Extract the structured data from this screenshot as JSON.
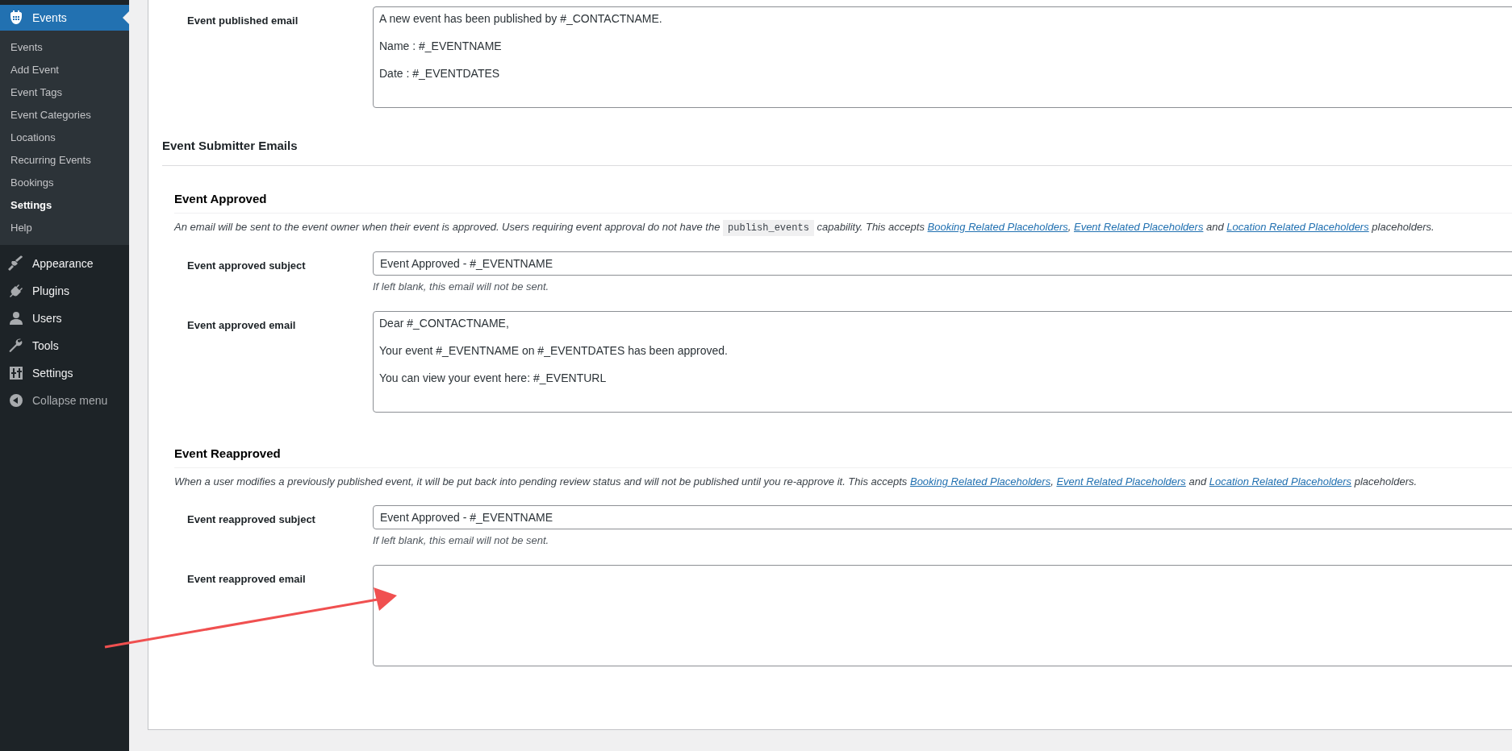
{
  "sidebar": {
    "current_menu": {
      "label": "Events"
    },
    "submenu": [
      {
        "label": "Events",
        "selected": false
      },
      {
        "label": "Add Event",
        "selected": false
      },
      {
        "label": "Event Tags",
        "selected": false
      },
      {
        "label": "Event Categories",
        "selected": false
      },
      {
        "label": "Locations",
        "selected": false
      },
      {
        "label": "Recurring Events",
        "selected": false
      },
      {
        "label": "Bookings",
        "selected": false
      },
      {
        "label": "Settings",
        "selected": true
      },
      {
        "label": "Help",
        "selected": false
      }
    ],
    "menu": [
      {
        "label": "Appearance",
        "kind": "brush"
      },
      {
        "label": "Plugins",
        "kind": "plug"
      },
      {
        "label": "Users",
        "kind": "user"
      },
      {
        "label": "Tools",
        "kind": "wrench"
      },
      {
        "label": "Settings",
        "kind": "sliders"
      },
      {
        "label": "Collapse menu",
        "kind": "collapse"
      }
    ]
  },
  "top_field": {
    "label": "Event published email",
    "kind": "textarea",
    "lines": [
      "A new event has been published by #_CONTACTNAME.",
      "Name : #_EVENTNAME",
      "Date : #_EVENTDATES"
    ]
  },
  "section_title": "Event Submitter Emails",
  "subsections": [
    {
      "title": "Event Approved",
      "description": [
        {
          "kind": "text",
          "text": "An email will be sent to the event owner when their event is approved. Users requiring event approval do not have the"
        },
        {
          "kind": "code",
          "text": "publish_events"
        },
        {
          "kind": "text",
          "text": "capability. This accepts"
        },
        {
          "kind": "link",
          "text": "Booking Related Placeholders"
        },
        {
          "kind": "text",
          "text": ","
        },
        {
          "kind": "link",
          "text": "Event Related Placeholders"
        },
        {
          "kind": "text",
          "text": "and"
        },
        {
          "kind": "link",
          "text": "Location Related Placeholders"
        },
        {
          "kind": "text",
          "text": "placeholders."
        }
      ],
      "fields": [
        {
          "label": "Event approved subject",
          "kind": "input",
          "value": "Event Approved - #_EVENTNAME",
          "hint": "If left blank, this email will not be sent."
        },
        {
          "label": "Event approved email",
          "kind": "textarea",
          "lines": [
            "Dear #_CONTACTNAME,",
            "Your event #_EVENTNAME on #_EVENTDATES has been approved.",
            "You can view your event here: #_EVENTURL"
          ]
        }
      ]
    },
    {
      "title": "Event Reapproved",
      "description": [
        {
          "kind": "text",
          "text": "When a user modifies a previously published event, it will be put back into pending review status and will not be published until you re-approve it. This accepts"
        },
        {
          "kind": "link",
          "text": "Booking Related Placeholders"
        },
        {
          "kind": "text",
          "text": ","
        },
        {
          "kind": "link",
          "text": "Event Related Placeholders"
        },
        {
          "kind": "text",
          "text": "and"
        },
        {
          "kind": "link",
          "text": "Location Related Placeholders"
        },
        {
          "kind": "text",
          "text": "placeholders."
        }
      ],
      "fields": [
        {
          "label": "Event reapproved subject",
          "kind": "input",
          "value": "Event Approved - #_EVENTNAME",
          "hint": "If left blank, this email will not be sent."
        },
        {
          "label": "Event reapproved email",
          "kind": "textarea"
        }
      ]
    }
  ]
}
